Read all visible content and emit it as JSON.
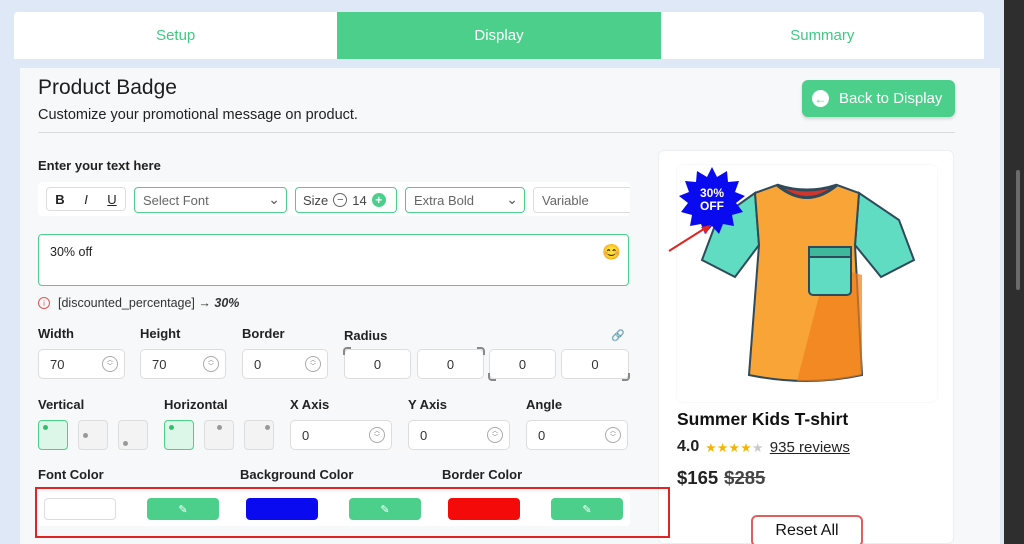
{
  "tabs": [
    "Setup",
    "Display",
    "Summary"
  ],
  "header": {
    "title": "Product Badge",
    "subtitle": "Customize your promotional message on product.",
    "back_label": "Back to Display"
  },
  "text_section": {
    "label": "Enter your text here",
    "bold": "B",
    "italic": "I",
    "underline": "U",
    "font_placeholder": "Select Font",
    "size_label": "Size",
    "size_value": "14",
    "weight": "Extra Bold",
    "variable": "Variable",
    "text_value": "30% off",
    "hint_token": "[discounted_percentage]",
    "hint_arrow": "→",
    "hint_value": "30%"
  },
  "dimensions": {
    "width_label": "Width",
    "width_value": "70",
    "height_label": "Height",
    "height_value": "70",
    "border_label": "Border",
    "border_value": "0",
    "radius_label": "Radius",
    "radius_values": [
      "0",
      "0",
      "0",
      "0"
    ]
  },
  "position": {
    "vertical_label": "Vertical",
    "horizontal_label": "Horizontal",
    "xaxis_label": "X Axis",
    "xaxis_value": "0",
    "yaxis_label": "Y Axis",
    "yaxis_value": "0",
    "angle_label": "Angle",
    "angle_value": "0"
  },
  "colors": {
    "font_label": "Font Color",
    "background_label": "Background Color",
    "border_label": "Border Color",
    "font_color": "#ffffff",
    "background_color": "#0a0af0",
    "border_color": "#f50a0a",
    "accent": "#4ccf8b"
  },
  "preview": {
    "badge_line1": "30%",
    "badge_line2": "OFF",
    "product_name": "Summer Kids T-shirt",
    "rating": "4.0",
    "stars_filled": 4,
    "stars_total": 5,
    "reviews": "935 reviews",
    "price": "$165",
    "old_price": "$285",
    "reset_label": "Reset All"
  }
}
